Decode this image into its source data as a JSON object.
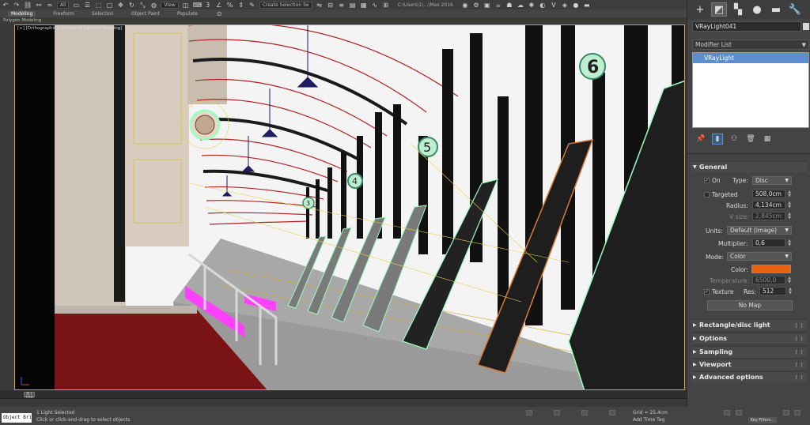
{
  "toolbar": {
    "undo_icon": "undo-icon",
    "redo_icon": "redo-icon",
    "view_dropdown": "All",
    "view_dropdown2": "View",
    "selection_set": "Create Selection Se",
    "window_title": "C:\\Users\\1\\...\\Max 2016"
  },
  "ribbon": {
    "tabs": [
      "Modeling",
      "Freeform",
      "Selection",
      "Object Paint",
      "Populate"
    ],
    "active_tab": "Modeling",
    "sub_label": "Polygon Modeling"
  },
  "viewport": {
    "label": "[+] [Orthographic] [Standard] [Default Shading]",
    "colors": {
      "wall": "#cfc4b8",
      "roof_line": "#b22222",
      "floor": "#8a8a8a",
      "carpet": "#7a1414",
      "escalator": "#1e1e1e",
      "highlight": "#9bffbf",
      "magenta": "#ff40ff",
      "frame": "#d6a92c"
    },
    "signs": [
      "6",
      "5",
      "4",
      "3"
    ]
  },
  "timeline": {
    "frame_label": "0 / 100"
  },
  "status": {
    "script_label": "Object Bridge",
    "selection_text": "1 Light Selected",
    "hint_text": "Click or click-and-drag to select objects",
    "grid_text": "Grid = 25,4cm",
    "add_time_tag": "Add Time Tag",
    "key_filters": "Key Filters..."
  },
  "command_panel": {
    "tabs": [
      "create-icon",
      "modify-icon",
      "hierarchy-icon",
      "motion-icon",
      "display-icon",
      "utilities-icon"
    ],
    "object_name": "VRayLight041",
    "modifier_list": "Modifier List",
    "stack_item": "VRayLight",
    "rollouts": {
      "general": {
        "title": "General",
        "on_label": "On",
        "on_checked": true,
        "type_label": "Type:",
        "type_value": "Disc",
        "targeted_label": "Targeted",
        "targeted_checked": false,
        "targeted_value": "508,0cm",
        "radius_label": "Radius:",
        "radius_value": "4,134cm",
        "vsize_label": "V size:",
        "vsize_value": "2,845cm",
        "units_label": "Units:",
        "units_value": "Default (image)",
        "multiplier_label": "Multiplier:",
        "multiplier_value": "0,6",
        "mode_label": "Mode:",
        "mode_value": "Color",
        "color_label": "Color:",
        "color_value": "#e8620f",
        "temperature_label": "Temperature:",
        "temperature_value": "6500,0",
        "texture_label": "Texture",
        "texture_checked": true,
        "res_label": "Res:",
        "res_value": "512",
        "nomap_label": "No Map"
      },
      "collapsed": [
        "Rectangle/disc light",
        "Options",
        "Sampling",
        "Viewport",
        "Advanced options"
      ]
    }
  }
}
